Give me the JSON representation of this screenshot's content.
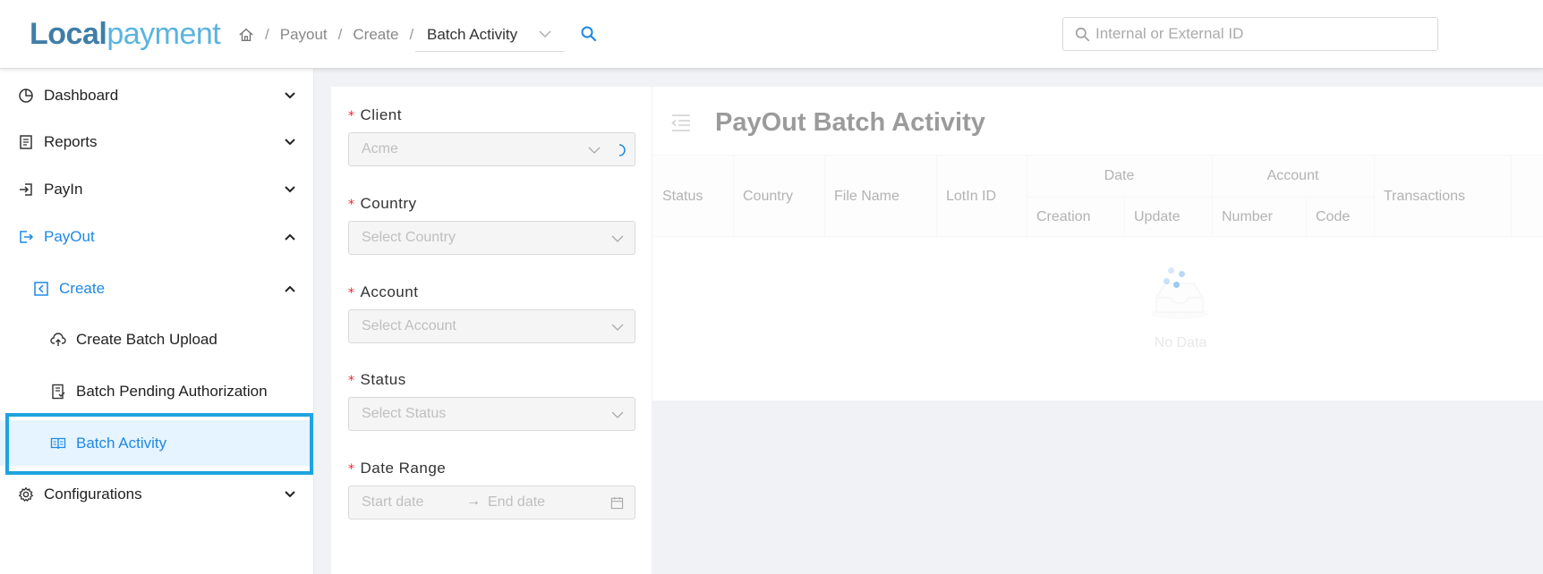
{
  "header": {
    "logo_part1": "Local",
    "logo_part2": "payment",
    "breadcrumb": [
      "Payout",
      "Create"
    ],
    "breadcrumb_sep": "/",
    "page_select": "Batch Activity",
    "id_search_placeholder": "Internal or External ID"
  },
  "sidebar": {
    "items": [
      {
        "label": "Dashboard",
        "icon": "pie-chart-icon",
        "expanded": false
      },
      {
        "label": "Reports",
        "icon": "report-icon",
        "expanded": false
      },
      {
        "label": "PayIn",
        "icon": "login-icon",
        "expanded": false
      },
      {
        "label": "PayOut",
        "icon": "logout-icon",
        "expanded": true
      },
      {
        "label": "Create",
        "icon": "left-square-icon",
        "expanded": true
      },
      {
        "label": "Create Batch Upload",
        "icon": "cloud-upload-icon"
      },
      {
        "label": "Batch Pending Authorization",
        "icon": "audit-icon"
      },
      {
        "label": "Batch Activity",
        "icon": "read-icon",
        "selected": true
      },
      {
        "label": "Configurations",
        "icon": "gear-icon",
        "expanded": false
      }
    ]
  },
  "filters": {
    "client": {
      "label": "Client",
      "value": "Acme"
    },
    "country": {
      "label": "Country",
      "placeholder": "Select Country"
    },
    "account": {
      "label": "Account",
      "placeholder": "Select Account"
    },
    "status": {
      "label": "Status",
      "placeholder": "Select Status"
    },
    "date_range": {
      "label": "Date Range",
      "start_placeholder": "Start date",
      "end_placeholder": "End date",
      "arrow": "→"
    },
    "required_mark": "*"
  },
  "content": {
    "title": "PayOut Batch Activity",
    "columns": {
      "status": "Status",
      "country": "Country",
      "file_name": "File Name",
      "lotin_id": "LotIn ID",
      "date": "Date",
      "creation": "Creation",
      "update": "Update",
      "account": "Account",
      "number": "Number",
      "code": "Code",
      "transactions": "Transactions"
    },
    "empty_text": "No Data"
  },
  "colors": {
    "accent": "#1e88e5",
    "highlight_border": "#1fa3e0",
    "required": "#f5222d"
  }
}
